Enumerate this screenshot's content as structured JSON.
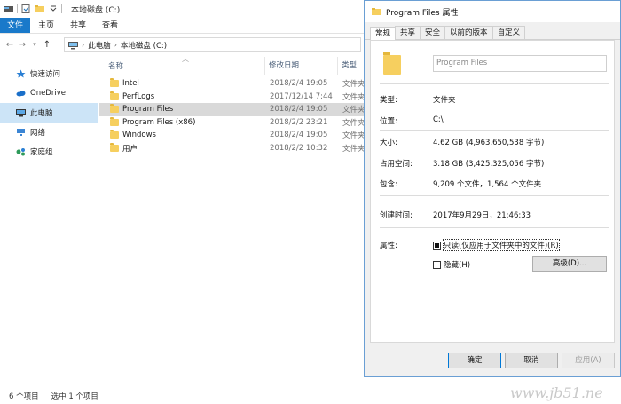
{
  "explorer": {
    "title": "本地磁盘 (C:)",
    "ribbon_tabs": [
      "文件",
      "主页",
      "共享",
      "查看"
    ],
    "breadcrumb": [
      "此电脑",
      "本地磁盘 (C:)"
    ],
    "sidebar": [
      "快速访问",
      "OneDrive",
      "此电脑",
      "网络",
      "家庭组"
    ],
    "columns": {
      "name": "名称",
      "date": "修改日期",
      "type": "类型"
    },
    "rows": [
      {
        "name": "Intel",
        "date": "2018/2/4 19:05",
        "type": "文件夹"
      },
      {
        "name": "PerfLogs",
        "date": "2017/12/14 7:44",
        "type": "文件夹"
      },
      {
        "name": "Program Files",
        "date": "2018/2/4 19:05",
        "type": "文件夹"
      },
      {
        "name": "Program Files (x86)",
        "date": "2018/2/2 23:21",
        "type": "文件夹"
      },
      {
        "name": "Windows",
        "date": "2018/2/4 19:05",
        "type": "文件夹"
      },
      {
        "name": "用户",
        "date": "2018/2/2 10:32",
        "type": "文件夹"
      }
    ],
    "status": {
      "count": "6 个项目",
      "selected": "选中 1 个项目"
    }
  },
  "dialog": {
    "title": "Program Files 属性",
    "tabs": [
      "常规",
      "共享",
      "安全",
      "以前的版本",
      "自定义"
    ],
    "name_value": "Program Files",
    "props": {
      "type_label": "类型:",
      "type_value": "文件夹",
      "location_label": "位置:",
      "location_value": "C:\\",
      "size_label": "大小:",
      "size_value": "4.62 GB (4,963,650,538 字节)",
      "disk_label": "占用空间:",
      "disk_value": "3.18 GB (3,425,325,056 字节)",
      "contains_label": "包含:",
      "contains_value": "9,209 个文件，1,564 个文件夹",
      "created_label": "创建时间:",
      "created_value": "2017年9月29日，21:46:33",
      "attr_label": "属性:",
      "readonly_label": "只读(仅应用于文件夹中的文件)(R)",
      "hidden_label": "隐藏(H)",
      "advanced_label": "高级(D)..."
    },
    "buttons": {
      "ok": "确定",
      "cancel": "取消",
      "apply": "应用(A)"
    }
  },
  "watermark": "www.jb51.ne",
  "colors": {
    "accent": "#1979ca",
    "selection": "#cce4f7",
    "folder": "#f6cf5f"
  }
}
